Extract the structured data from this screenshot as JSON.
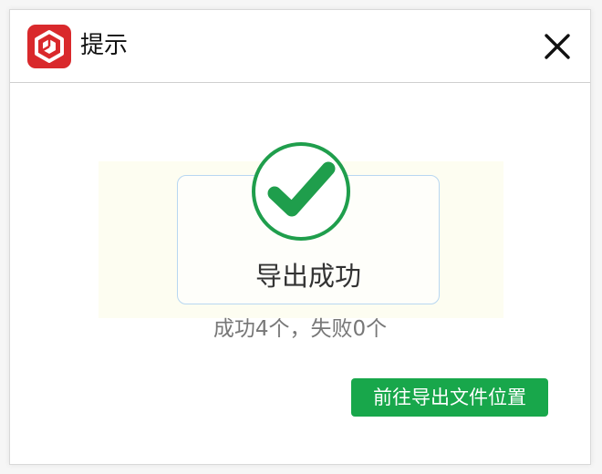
{
  "dialog": {
    "title": "提示",
    "message": "导出成功",
    "summary": "成功4个，失败0个",
    "action_label": "前往导出文件位置"
  },
  "colors": {
    "logo_red": "#d9292c",
    "success_green": "#1f9e4c",
    "button_green": "#18a74b",
    "box_border_blue": "#b8d7f1"
  },
  "icons": {
    "app": "app-logo-icon",
    "close": "close-icon",
    "success": "check-circle-icon"
  }
}
